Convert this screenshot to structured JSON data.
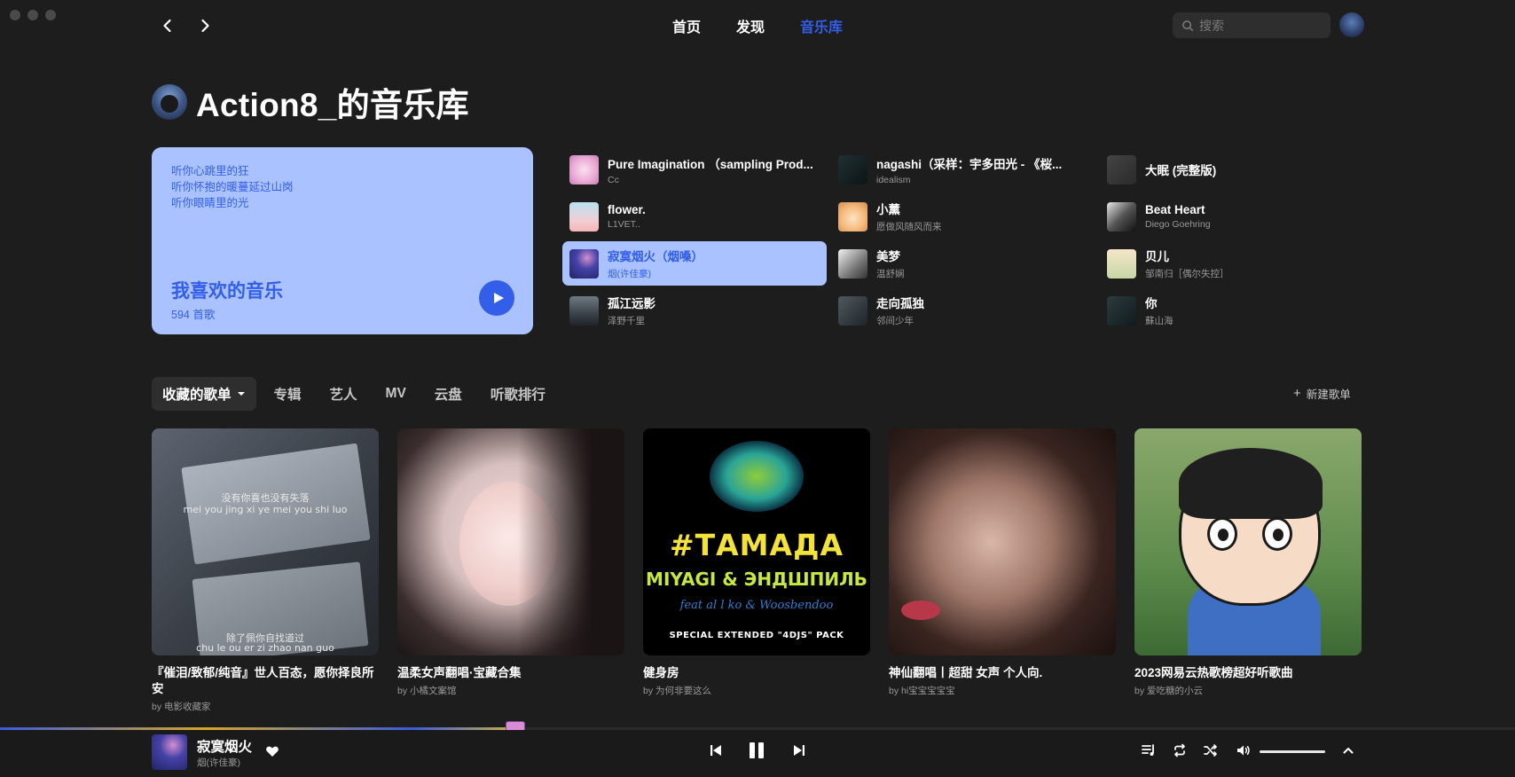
{
  "nav": {
    "links": [
      "首页",
      "发现",
      "音乐库"
    ],
    "active_index": 2,
    "search_placeholder": "搜索"
  },
  "header": {
    "title": "Action8_的音乐库"
  },
  "liked": {
    "lyrics": [
      "听你心跳里的狂",
      "听你怀抱的暖蔓延过山岗",
      "听你眼睛里的光"
    ],
    "title": "我喜欢的音乐",
    "count": "594 首歌"
  },
  "songs": [
    {
      "name": "Pure Imagination （sampling Prod...",
      "artist": "Cc",
      "cover": "pink"
    },
    {
      "name": "nagashi（采样：宇多田光 - 《桜...",
      "artist": "idealism",
      "cover": "dark1"
    },
    {
      "name": "大眠 (完整版)",
      "artist": "",
      "cover": "gray"
    },
    {
      "name": "flower.",
      "artist": "L1VET..",
      "cover": "sky"
    },
    {
      "name": "小薰",
      "artist": "愿做风随风而来",
      "cover": "anime"
    },
    {
      "name": "Beat Heart",
      "artist": "Diego Goehring",
      "cover": "bw"
    },
    {
      "name": "寂寞烟火（烟嗓）",
      "artist": "烟(许佳豪)",
      "cover": "navy",
      "active": true
    },
    {
      "name": "美梦",
      "artist": "温舒娴",
      "cover": "mono"
    },
    {
      "name": "贝儿",
      "artist": "邹南归［偶尔失控］",
      "cover": "kids"
    },
    {
      "name": "孤江远影",
      "artist": "泽野千里",
      "cover": "fog"
    },
    {
      "name": "走向孤独",
      "artist": "邻间少年",
      "cover": "night"
    },
    {
      "name": "你",
      "artist": "蘇山海",
      "cover": "teal"
    }
  ],
  "tabs": {
    "items": [
      "收藏的歌单",
      "专辑",
      "艺人",
      "MV",
      "云盘",
      "听歌排行"
    ],
    "active_index": 0,
    "new_playlist": "新建歌单"
  },
  "playlists": [
    {
      "title": "『催泪/致郁/纯音』世人百态，愿你择良所安",
      "by": "by 电影收藏家",
      "cover_caption_top": "没有你喜也没有失落",
      "cover_caption_top_pinyin": "mei you jing xi ye mei you shi luo",
      "cover_caption_bottom": "除了佩你自找道过",
      "cover_caption_bottom_pinyin": "chu le ou er zi zhao nan guo"
    },
    {
      "title": "温柔女声翻唱·宝藏合集",
      "by": "by 小橘文案馆"
    },
    {
      "title": "健身房",
      "by": "by 为何非要这么",
      "cover_text": [
        "#ТАМАДА",
        "MIYAGI & ЭНДШПИЛЬ",
        "feat al l ko & Woosbendoo",
        "SPECIAL EXTENDED \"4DJS\" PACK"
      ]
    },
    {
      "title": "神仙翻唱丨超甜 女声 个人向.",
      "by": "by hi宝宝宝宝宝"
    },
    {
      "title": "2023网易云热歌榜超好听歌曲",
      "by": "by 爱吃糖的小云"
    }
  ],
  "player": {
    "title": "寂寞烟火",
    "artist": "烟(许佳豪)",
    "progress": 0.34,
    "volume": 1.0
  },
  "colors": {
    "accent": "#335eea",
    "accent_light": "#aac2ff",
    "background": "#1d1d1d"
  }
}
